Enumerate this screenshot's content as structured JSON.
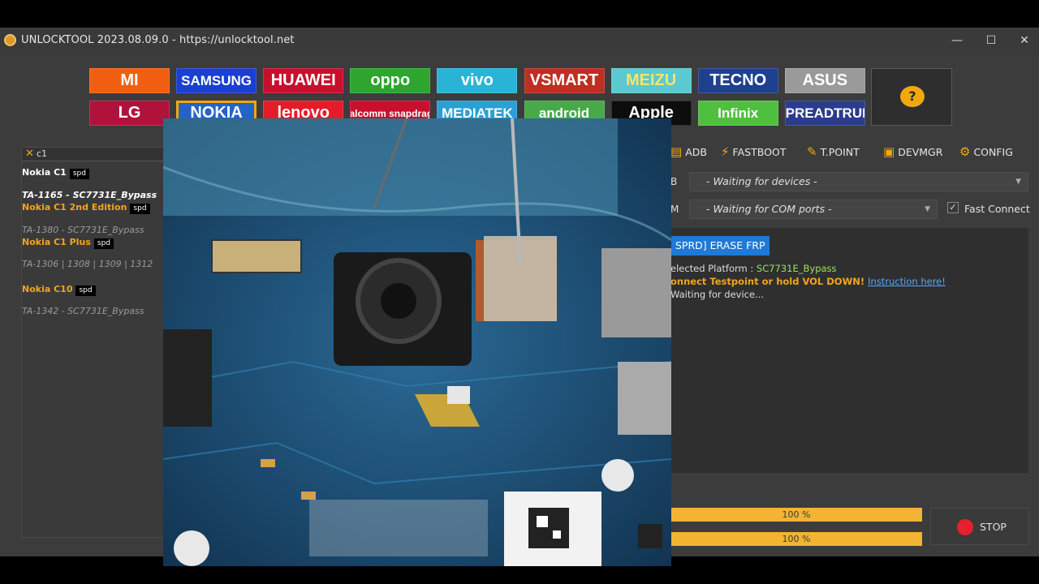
{
  "window": {
    "title": "UNLOCKTOOL 2023.08.09.0 - https://unlocktool.net",
    "controls": {
      "minimize": "—",
      "maximize": "☐",
      "close": "✕"
    }
  },
  "brands": [
    {
      "name": "mi",
      "label": "MI",
      "bg": "#f25e12",
      "color": "#ffffff"
    },
    {
      "name": "samsung",
      "label": "SAMSUNG",
      "bg": "#1b3fd3",
      "color": "#ffffff"
    },
    {
      "name": "huawei",
      "label": "HUAWEI",
      "bg": "#c8102e",
      "color": "#ffffff"
    },
    {
      "name": "oppo",
      "label": "oppo",
      "bg": "#2ea52e",
      "color": "#ffffff"
    },
    {
      "name": "vivo",
      "label": "vivo",
      "bg": "#29b4d6",
      "color": "#ffffff"
    },
    {
      "name": "vsmart",
      "label": "VSMART",
      "bg": "#bf2e22",
      "color": "#ffffff"
    },
    {
      "name": "meizu",
      "label": "MEIZU",
      "bg": "#5cc8cf",
      "color": "#f7e46a"
    },
    {
      "name": "tecno",
      "label": "TECNO",
      "bg": "#1f3f8f",
      "color": "#ffffff"
    },
    {
      "name": "asus",
      "label": "ASUS",
      "bg": "#9a9a9a",
      "color": "#ffffff"
    },
    {
      "name": "lg",
      "label": "LG",
      "bg": "#b0123b",
      "color": "#ffffff"
    },
    {
      "name": "nokia",
      "label": "NOKIA",
      "bg": "#2463c8",
      "color": "#ffffff"
    },
    {
      "name": "lenovo",
      "label": "lenovo",
      "bg": "#e41c2a",
      "color": "#ffffff"
    },
    {
      "name": "qualcomm",
      "label": "Qualcomm snapdragon",
      "bg": "#c8102e",
      "color": "#ffffff"
    },
    {
      "name": "mediatek",
      "label": "MEDIATEK",
      "bg": "#2aa0d4",
      "color": "#ffffff"
    },
    {
      "name": "android",
      "label": "android",
      "bg": "#48a94a",
      "color": "#ffffff"
    },
    {
      "name": "apple",
      "label": "Apple",
      "bg": "#0d0d0d",
      "color": "#ffffff"
    },
    {
      "name": "infinix",
      "label": "Infinix",
      "bg": "#4fbf3f",
      "color": "#ffffff"
    },
    {
      "name": "spreadtrum",
      "label": "SPREADTRUM",
      "bg": "#2b3c8c",
      "color": "#ffffff"
    }
  ],
  "help": {
    "icon": "?"
  },
  "search": {
    "icon": "✕",
    "value": "c1"
  },
  "models": [
    {
      "label": "Nokia C1",
      "tag": "spd",
      "style": "white"
    },
    {
      "label": "TA-1165 - SC7731E_Bypass",
      "tag": "",
      "style": "whiteital"
    },
    {
      "label": "Nokia C1 2nd Edition",
      "tag": "spd",
      "style": "orange"
    },
    {
      "label": "TA-1380 - SC7731E_Bypass",
      "tag": "",
      "style": "grey"
    },
    {
      "label": "Nokia C1 Plus",
      "tag": "spd",
      "style": "orange"
    },
    {
      "label": "TA-1306 | 1308 | 1309 | 1312",
      "tag": "",
      "style": "grey"
    },
    {
      "label": "Nokia C10",
      "tag": "spd",
      "style": "orange"
    },
    {
      "label": "TA-1342 - SC7731E_Bypass",
      "tag": "",
      "style": "grey"
    }
  ],
  "toolbar": [
    {
      "name": "adb",
      "icon": "▤",
      "label": "ADB"
    },
    {
      "name": "fastboot",
      "icon": "⚡",
      "label": "FASTBOOT"
    },
    {
      "name": "tpoint",
      "icon": "✎",
      "label": "T.POINT"
    },
    {
      "name": "devmgr",
      "icon": "▣",
      "label": "DEVMGR"
    },
    {
      "name": "config",
      "icon": "⚙",
      "label": "CONFIG"
    }
  ],
  "usb": {
    "label": "B",
    "value": "- Waiting for devices -"
  },
  "com": {
    "label": "M",
    "value": "- Waiting for COM ports -"
  },
  "fast_connect": {
    "checked": "✓",
    "label": "Fast Connect"
  },
  "operation": {
    "chip": "SPRD] ERASE FRP"
  },
  "log": {
    "line1_prefix": "elected Platform : ",
    "line1_value": "SC7731E_Bypass",
    "line2_text": "onnect Testpoint or hold VOL DOWN! ",
    "line2_link": "Instruction here!",
    "line3": "Waiting for device..."
  },
  "progress": {
    "bar1": "100 %",
    "bar2": "100 %",
    "fraction1": 1.0,
    "fraction2": 1.0
  },
  "stop": {
    "label": "STOP"
  },
  "colors": {
    "accent": "#f1a80e",
    "panel": "#3c3c3c",
    "highlight": "#1f79d6",
    "progress": "#f2b432",
    "stop": "#e81f2e"
  }
}
